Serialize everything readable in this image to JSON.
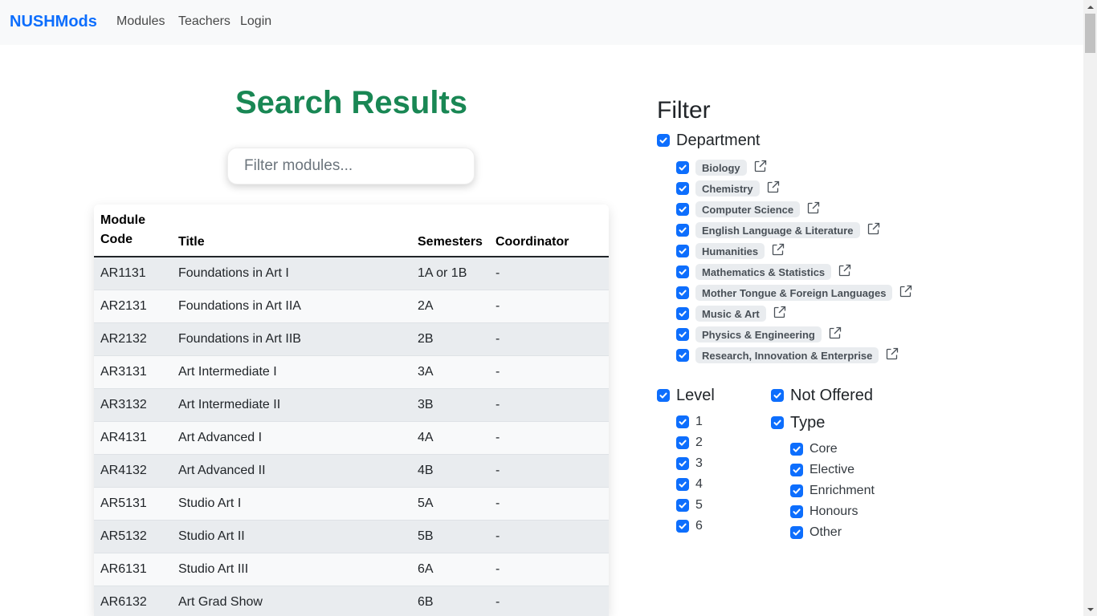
{
  "nav": {
    "brand": "NUSHMods",
    "links": [
      "Modules",
      "Teachers",
      "Login"
    ]
  },
  "main": {
    "title": "Search Results",
    "search_placeholder": "Filter modules...",
    "columns": [
      "Module Code",
      "Title",
      "Semesters",
      "Coordinator"
    ],
    "rows": [
      [
        "AR1131",
        "Foundations in Art I",
        "1A or 1B",
        "-"
      ],
      [
        "AR2131",
        "Foundations in Art IIA",
        "2A",
        "-"
      ],
      [
        "AR2132",
        "Foundations in Art IIB",
        "2B",
        "-"
      ],
      [
        "AR3131",
        "Art Intermediate I",
        "3A",
        "-"
      ],
      [
        "AR3132",
        "Art Intermediate II",
        "3B",
        "-"
      ],
      [
        "AR4131",
        "Art Advanced I",
        "4A",
        "-"
      ],
      [
        "AR4132",
        "Art Advanced II",
        "4B",
        "-"
      ],
      [
        "AR5131",
        "Studio Art I",
        "5A",
        "-"
      ],
      [
        "AR5132",
        "Studio Art II",
        "5B",
        "-"
      ],
      [
        "AR6131",
        "Studio Art III",
        "6A",
        "-"
      ],
      [
        "AR6132",
        "Art Grad Show",
        "6B",
        "-"
      ]
    ]
  },
  "filter": {
    "title": "Filter",
    "department": {
      "label": "Department",
      "checked": true,
      "items": [
        "Biology",
        "Chemistry",
        "Computer Science",
        "English Language & Literature",
        "Humanities",
        "Mathematics & Statistics",
        "Mother Tongue & Foreign Languages",
        "Music & Art",
        "Physics & Engineering",
        "Research, Innovation & Enterprise"
      ]
    },
    "level": {
      "label": "Level",
      "checked": true,
      "items": [
        "1",
        "2",
        "3",
        "4",
        "5",
        "6"
      ]
    },
    "not_offered": {
      "label": "Not Offered",
      "checked": true
    },
    "type": {
      "label": "Type",
      "checked": true,
      "items": [
        "Core",
        "Elective",
        "Enrichment",
        "Honours",
        "Other"
      ]
    }
  },
  "colors": {
    "brand": "#0d6efd",
    "title": "#198754",
    "checkbox": "#0d6efd"
  }
}
